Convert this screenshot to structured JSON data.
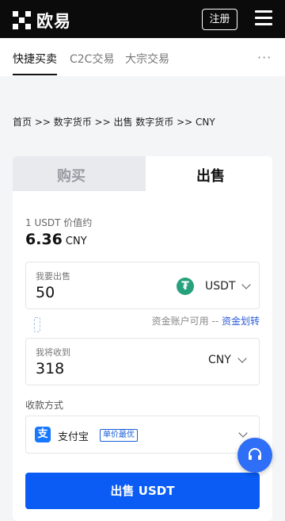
{
  "header": {
    "brand": "欧易",
    "register_label": "注册"
  },
  "tabs": [
    {
      "label": "快捷买卖",
      "active": true
    },
    {
      "label": "C2C交易",
      "active": false
    },
    {
      "label": "大宗交易",
      "active": false
    }
  ],
  "more_label": "···",
  "breadcrumb": "首页 >> 数字货币 >> 出售 数字货币 >> CNY",
  "trade": {
    "buy_label": "购买",
    "sell_label": "出售",
    "active_side": "sell",
    "rate_label": "1 USDT 价值约",
    "rate_value": "6.36",
    "rate_unit": "CNY",
    "sell_field": {
      "label": "我要出售",
      "value": "50",
      "currency": "USDT",
      "currency_icon": "₮"
    },
    "available_label": "资金账户可用 --",
    "transfer_link": "资金划转",
    "receive_field": {
      "label": "我将收到",
      "value": "318",
      "currency": "CNY"
    },
    "payment_label": "收款方式",
    "payment": {
      "name": "支付宝",
      "icon": "支",
      "badge": "单价最优"
    },
    "submit_label": "出售 USDT"
  },
  "colors": {
    "primary": "#0a5cf5",
    "header_bg": "#0b0b0b",
    "usdt": "#26a17b",
    "alipay": "#1677ff"
  }
}
